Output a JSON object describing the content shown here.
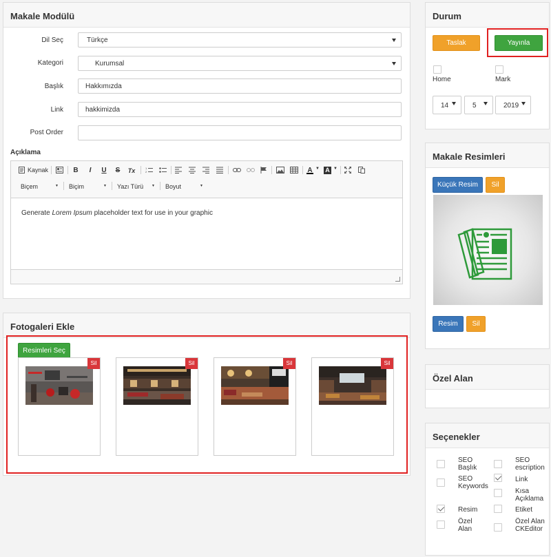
{
  "makale": {
    "title": "Makale Modülü",
    "fields": [
      {
        "label": "Dil Seç",
        "value": "Türkçe"
      },
      {
        "label": "Kategori",
        "value": "Kurumsal"
      },
      {
        "label": "Başlık",
        "value": "Hakkımızda"
      },
      {
        "label": "Link",
        "value": "hakkimizda"
      },
      {
        "label": "Post Order",
        "value": ""
      }
    ],
    "aciklama_label": "Açıklama",
    "editor": {
      "kaynak": "Kaynak",
      "bold": "B",
      "italic": "I",
      "underline": "U",
      "strike": "S",
      "clear": "Tx",
      "textcolor": "A",
      "bgcolor": "A",
      "dropdowns": [
        "Biçem",
        "Biçim",
        "Yazı Türü",
        "Boyut"
      ],
      "content_pre": "Generate ",
      "content_em": "Lorem Ipsum",
      "content_post": " placeholder text for use in your graphic"
    }
  },
  "fotogaleri": {
    "title": "Fotogaleri Ekle",
    "select_button": "Resimleri Seç",
    "delete_label": "Sil",
    "photos": [
      {
        "name": "restaurant-photo-1"
      },
      {
        "name": "restaurant-photo-2"
      },
      {
        "name": "restaurant-photo-3"
      },
      {
        "name": "restaurant-photo-4"
      }
    ]
  },
  "durum": {
    "title": "Durum",
    "taslak": "Taslak",
    "yayinla": "Yayınla",
    "home": "Home",
    "mark": "Mark",
    "day": "14",
    "month": "5",
    "year": "2019"
  },
  "resimler": {
    "title": "Makale Resimleri",
    "kucuk": "Küçük Resim",
    "sil1": "Sil",
    "resim": "Resim",
    "sil2": "Sil"
  },
  "ozel": {
    "title": "Özel Alan"
  },
  "secenekler": {
    "title": "Seçenekler",
    "left": [
      {
        "label": "SEO Başlık",
        "checked": false
      },
      {
        "label": "SEO Keywords",
        "checked": false
      },
      {
        "label": "Resim",
        "checked": true
      },
      {
        "label": "Özel Alan",
        "checked": false
      }
    ],
    "right": [
      {
        "label": "SEO escription",
        "checked": false
      },
      {
        "label": "Link",
        "checked": true
      },
      {
        "label": "Kısa Açıklama",
        "checked": false
      },
      {
        "label": "Etiket",
        "checked": false
      },
      {
        "label": "Özel Alan CKEditor",
        "checked": false
      }
    ]
  },
  "colors": {
    "orange": "#f0a12a",
    "green": "#3fa43f",
    "blue": "#3a76b9",
    "red": "#d9363a",
    "highlight": "#e02020"
  }
}
